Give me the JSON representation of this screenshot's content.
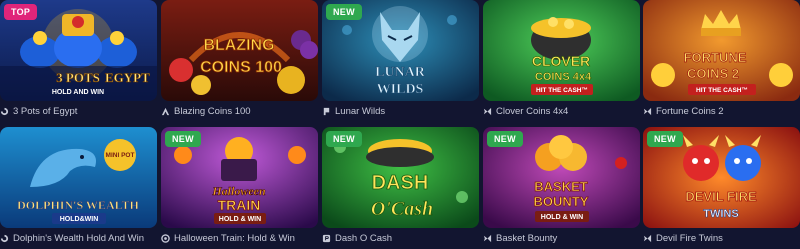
{
  "colors": {
    "page_bg": "#121530",
    "caption_text": "#c7cad8",
    "badge_top": "#e0257a",
    "badge_new": "#2fa84f"
  },
  "games": [
    {
      "title": "3 Pots of Egypt",
      "art_title_1": "3 POTS",
      "art_title_2": "EGYPT",
      "art_sub": "HOLD AND WIN",
      "badge": "TOP",
      "provider_icon": "swirl-provider-icon"
    },
    {
      "title": "Blazing Coins 100",
      "art_title_1": "BLAZING",
      "art_title_2": "COINS 100",
      "badge": "",
      "provider_icon": "a-provider-icon"
    },
    {
      "title": "Lunar Wilds",
      "art_title_1": "LUNAR",
      "art_title_2": "WILDS",
      "badge": "NEW",
      "provider_icon": "flag-provider-icon"
    },
    {
      "title": "Clover Coins 4x4",
      "art_title_1": "CLOVER",
      "art_title_2": "COINS 4x4",
      "art_sub": "HIT THE CASH™",
      "badge": "",
      "provider_icon": "wing-provider-icon"
    },
    {
      "title": "Fortune Coins 2",
      "art_title_1": "FORTUNE",
      "art_title_2": "COINS 2",
      "art_sub": "HIT THE CASH™",
      "badge": "",
      "provider_icon": "wing-provider-icon"
    },
    {
      "title": "Dolphin's Wealth Hold And Win",
      "art_title_1": "DOLPHIN'S WEALTH",
      "art_sub": "HOLD&WIN",
      "art_extra": "MINI POT",
      "badge": "",
      "provider_icon": "swirl-provider-icon"
    },
    {
      "title": "Halloween Train: Hold & Win",
      "art_title_1": "Halloween",
      "art_title_2": "TRAIN",
      "art_sub": "HOLD & WIN",
      "badge": "NEW",
      "provider_icon": "circle-provider-icon"
    },
    {
      "title": "Dash O Cash",
      "art_title_1": "DASH",
      "art_title_2": "O'Cash",
      "badge": "NEW",
      "provider_icon": "p-provider-icon"
    },
    {
      "title": "Basket Bounty",
      "art_title_1": "BASKET",
      "art_title_2": "BOUNTY",
      "art_sub": "HOLD & WIN",
      "badge": "NEW",
      "provider_icon": "wing-provider-icon"
    },
    {
      "title": "Devil Fire Twins",
      "art_title_1": "DEVIL FIRE",
      "art_title_2": "TWINS",
      "badge": "NEW",
      "provider_icon": "wing-provider-icon"
    }
  ]
}
